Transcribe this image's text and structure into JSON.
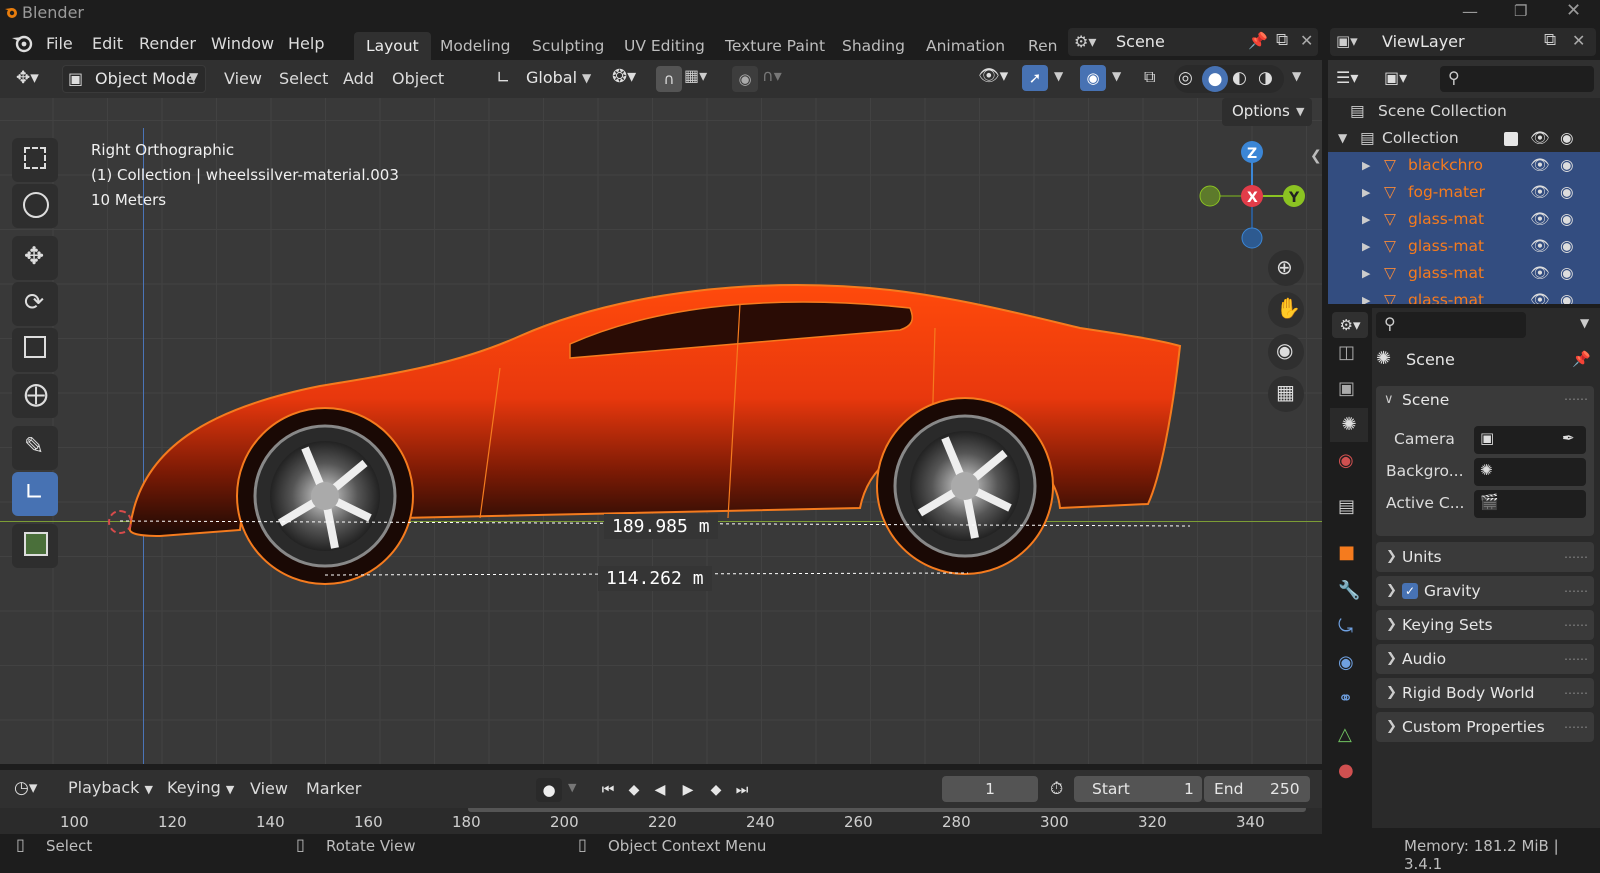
{
  "app": {
    "title": "Blender",
    "window_controls": [
      "minimize-icon",
      "restore-icon",
      "close-icon"
    ]
  },
  "menu": {
    "file": "File",
    "edit": "Edit",
    "render": "Render",
    "window": "Window",
    "help": "Help"
  },
  "workspaces": [
    "Layout",
    "Modeling",
    "Sculpting",
    "UV Editing",
    "Texture Paint",
    "Shading",
    "Animation",
    "Ren"
  ],
  "active_workspace": "Layout",
  "scene_selector": {
    "value": "Scene"
  },
  "viewlayer_selector": {
    "value": "ViewLayer"
  },
  "viewport_header": {
    "mode": "Object Mode",
    "view": "View",
    "select": "Select",
    "add": "Add",
    "object": "Object",
    "orientation": "Global",
    "options": "Options"
  },
  "viewport": {
    "view_name": "Right Orthographic",
    "collection_info": "(1) Collection | wheelssilver-material.003",
    "scale": "10 Meters",
    "measure_1": "189.985 m",
    "measure_2": "114.262 m",
    "gizmo": {
      "z": "Z",
      "x": "X",
      "y": "Y"
    }
  },
  "outliner": {
    "root": "Scene Collection",
    "collection": "Collection",
    "items": [
      "blackchro",
      "fog-mater",
      "glass-mat",
      "glass-mat",
      "glass-mat",
      "glass-mat"
    ]
  },
  "properties": {
    "title": "Scene",
    "section": "Scene",
    "camera_label": "Camera",
    "background_label": "Backgro...",
    "active_clip_label": "Active C...",
    "panels": [
      "Units",
      "Gravity",
      "Keying Sets",
      "Audio",
      "Rigid Body World",
      "Custom Properties"
    ],
    "gravity_checked": true
  },
  "timeline": {
    "playback": "Playback",
    "keying": "Keying",
    "view": "View",
    "marker": "Marker",
    "current_frame": "1",
    "start_label": "Start",
    "start": "1",
    "end_label": "End",
    "end": "250",
    "ruler": [
      "100",
      "120",
      "140",
      "160",
      "180",
      "200",
      "220",
      "240",
      "260",
      "280",
      "300",
      "320",
      "340"
    ]
  },
  "status": {
    "select": "Select",
    "rotate": "Rotate View",
    "context": "Object Context Menu",
    "memory": "Memory: 181.2 MiB | 3.4.1"
  },
  "colors": {
    "accent_blue": "#4772b3",
    "selection_orange": "#f57b1e",
    "car_red": "#e8380d",
    "gizmo_x": "#e23c49",
    "gizmo_y": "#8bc322",
    "gizmo_z": "#3b86d6"
  }
}
